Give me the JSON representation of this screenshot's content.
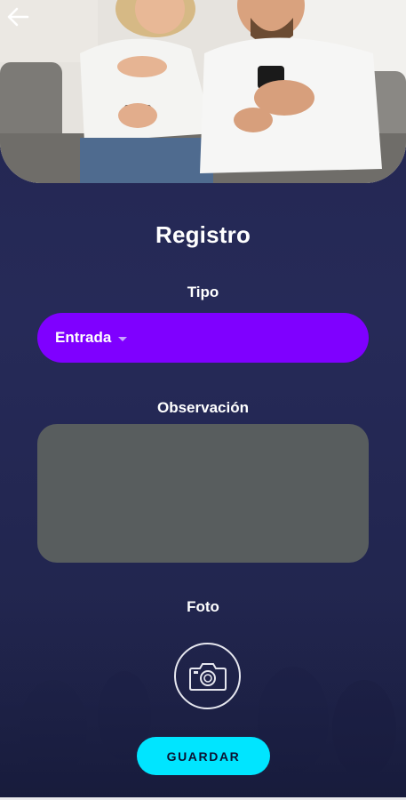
{
  "header": {
    "back_icon": "arrow-left-icon",
    "image": "couple-with-phones-photo"
  },
  "form": {
    "title": "Registro",
    "tipo": {
      "label": "Tipo",
      "selected": "Entrada",
      "icon": "dropdown-caret-icon"
    },
    "observacion": {
      "label": "Observación",
      "value": ""
    },
    "foto": {
      "label": "Foto",
      "icon": "camera-icon"
    },
    "save_label": "GUARDAR"
  },
  "colors": {
    "background": "#23264e",
    "select_bg": "#7f00ff",
    "textarea_bg": "#585d5e",
    "save_bg": "#00e5ff",
    "text": "#ffffff"
  }
}
